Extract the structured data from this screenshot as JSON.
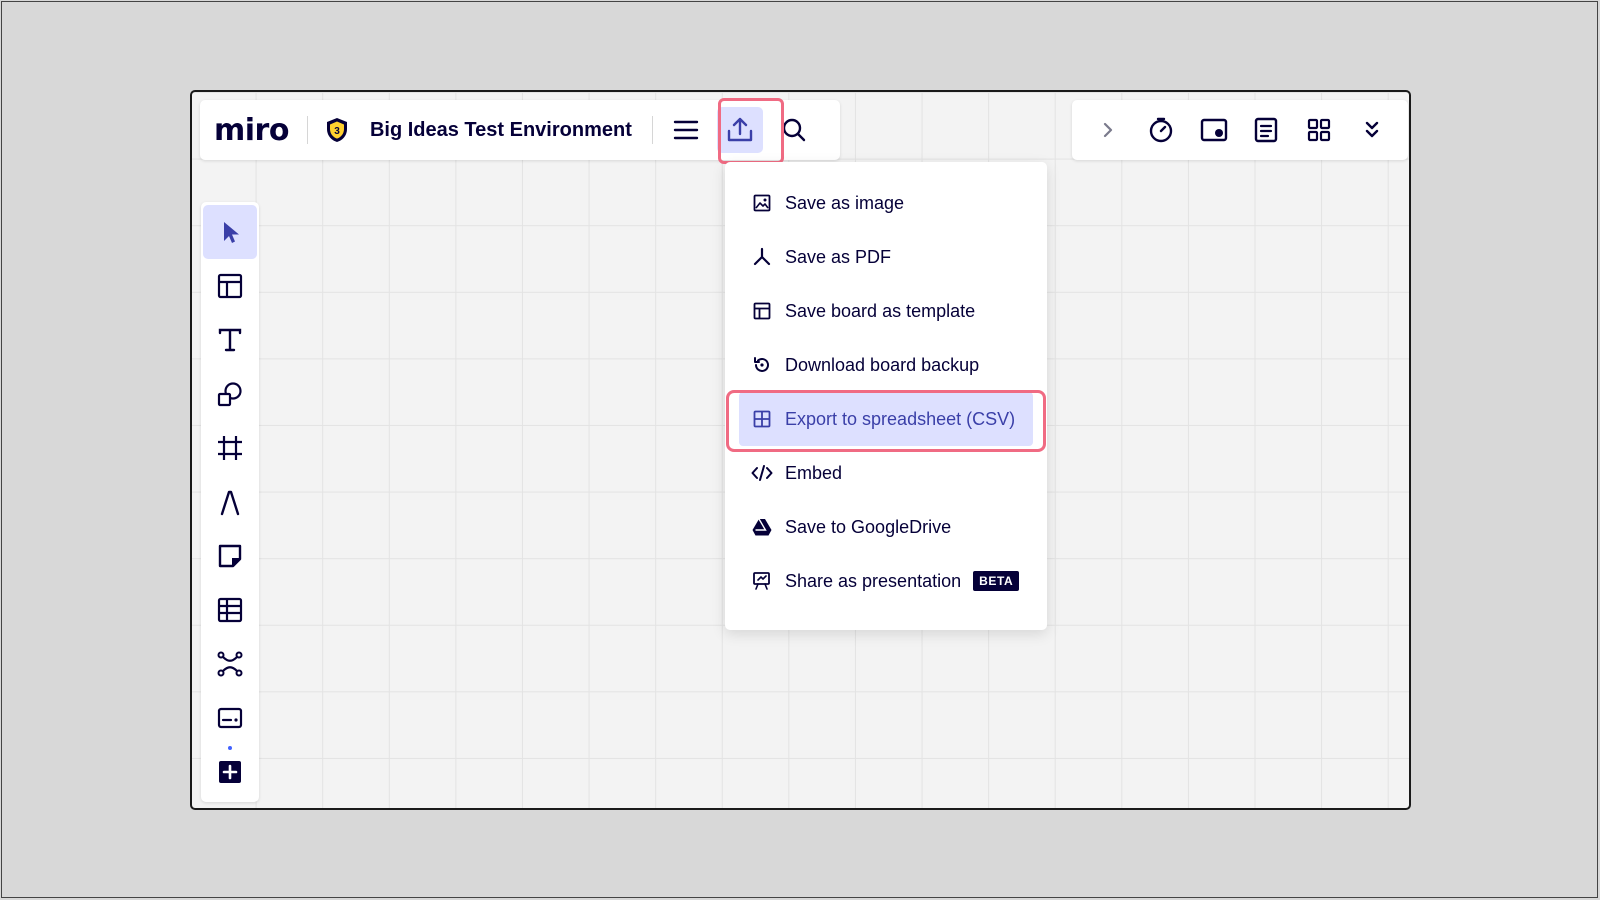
{
  "app": {
    "logo_text": "miro",
    "board_title": "Big Ideas Test Environment",
    "plan_badge": "3"
  },
  "topbar_left": {
    "icons": [
      "shield-badge-icon",
      "menu-icon",
      "export-icon",
      "search-icon"
    ],
    "active": "export-icon"
  },
  "topbar_right": {
    "icons": [
      "chevron-right-icon",
      "timer-icon",
      "screen-share-icon",
      "notes-icon",
      "apps-grid-icon",
      "double-chevron-down-icon"
    ]
  },
  "left_toolbar": {
    "tools": [
      "select",
      "templates",
      "text",
      "shapes",
      "frame",
      "pen",
      "sticky-note",
      "table",
      "mind-map",
      "card",
      "add-more"
    ],
    "selected": "select"
  },
  "export_menu": {
    "items": [
      {
        "label": "Save as image",
        "icon": "image-icon"
      },
      {
        "label": "Save as PDF",
        "icon": "pdf-icon"
      },
      {
        "label": "Save board as template",
        "icon": "template-icon"
      },
      {
        "label": "Download board backup",
        "icon": "backup-icon"
      },
      {
        "label": "Export to spreadsheet (CSV)",
        "icon": "spreadsheet-icon",
        "active": true
      },
      {
        "label": "Embed",
        "icon": "code-icon"
      },
      {
        "label": "Save to GoogleDrive",
        "icon": "google-drive-icon"
      },
      {
        "label": "Share as presentation",
        "icon": "presentation-icon",
        "badge": "BETA"
      }
    ]
  },
  "colors": {
    "highlight": "#f06b83",
    "active_bg": "#dde0ff",
    "ink": "#050038",
    "badge_yellow": "#ffd02f"
  }
}
